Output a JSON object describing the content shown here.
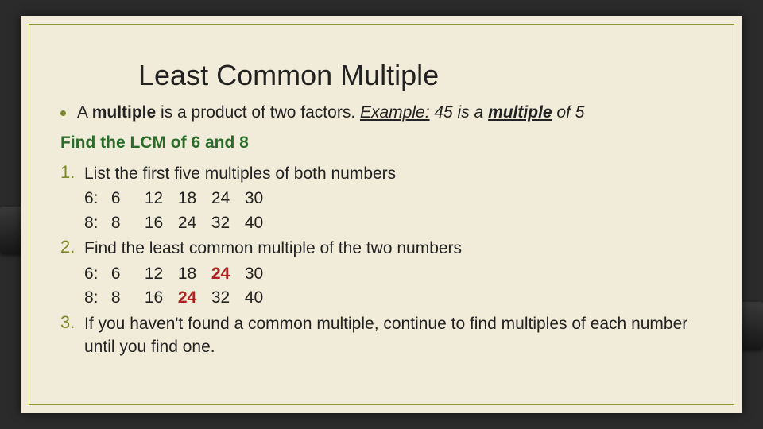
{
  "title": "Least Common Multiple",
  "bullet": {
    "pre": "A ",
    "term": "multiple",
    "mid": " is a product of two factors. ",
    "ex_label": "Example:",
    "ex_text": "  45 is a ",
    "ex_term": "multiple",
    "ex_tail": " of 5"
  },
  "subhead": "Find the LCM of 6 and 8",
  "steps": [
    {
      "num": "1.",
      "text": "List the first five multiples of both numbers",
      "rows": [
        {
          "lbl": "6:",
          "vals": [
            "6",
            "12",
            "18",
            "24",
            "30"
          ],
          "hl": []
        },
        {
          "lbl": "8:",
          "vals": [
            "8",
            "16",
            "24",
            "32",
            "40"
          ],
          "hl": []
        }
      ]
    },
    {
      "num": "2.",
      "text": "Find the least common multiple of the two numbers",
      "rows": [
        {
          "lbl": "6:",
          "vals": [
            "6",
            "12",
            "18",
            "24",
            "30"
          ],
          "hl": [
            3
          ]
        },
        {
          "lbl": "8:",
          "vals": [
            "8",
            "16",
            "24",
            "32",
            "40"
          ],
          "hl": [
            2
          ]
        }
      ]
    },
    {
      "num": "3.",
      "text": "If you haven't found a common multiple, continue to find multiples of each number until you find one.",
      "rows": []
    }
  ]
}
